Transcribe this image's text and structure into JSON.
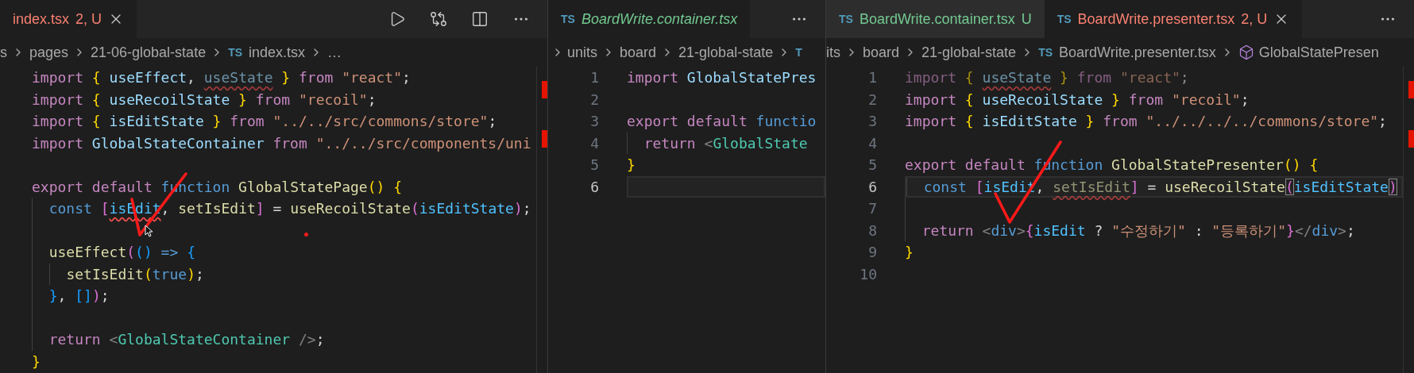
{
  "panes": [
    {
      "tabs": [
        {
          "label": "index.tsx",
          "decoration": "2, U",
          "color": "#f88070",
          "selected": true,
          "closable": true
        }
      ],
      "actions": [
        {
          "kind": "run"
        },
        {
          "kind": "compare"
        },
        {
          "kind": "split"
        },
        {
          "kind": "more"
        }
      ],
      "breadcrumbs": {
        "items": [
          {
            "text": "s"
          },
          {
            "text": "pages"
          },
          {
            "text": "21-06-global-state"
          },
          {
            "badge": "TS",
            "text": "index.tsx"
          },
          {
            "text": "…"
          }
        ]
      },
      "lines": [
        {
          "kind": "code",
          "tokens": [
            {
              "text": "import ",
              "kind": "kw"
            },
            {
              "text": "{ ",
              "kind": "br"
            },
            {
              "text": "useEffect",
              "kind": "id"
            },
            {
              "text": ", ",
              "kind": "plain"
            },
            {
              "text": "useState",
              "kind": "id",
              "faded": true,
              "squiggle": true
            },
            {
              "text": " } ",
              "kind": "br"
            },
            {
              "text": "from ",
              "kind": "kw"
            },
            {
              "text": "\"react\"",
              "kind": "str"
            },
            {
              "text": ";",
              "kind": "plain"
            }
          ]
        },
        {
          "kind": "code",
          "tokens": [
            {
              "text": "import ",
              "kind": "kw"
            },
            {
              "text": "{ ",
              "kind": "br"
            },
            {
              "text": "useRecoilState",
              "kind": "id"
            },
            {
              "text": " } ",
              "kind": "br"
            },
            {
              "text": "from ",
              "kind": "kw"
            },
            {
              "text": "\"recoil\"",
              "kind": "str"
            },
            {
              "text": ";",
              "kind": "plain"
            }
          ]
        },
        {
          "kind": "code",
          "tokens": [
            {
              "text": "import ",
              "kind": "kw"
            },
            {
              "text": "{ ",
              "kind": "br"
            },
            {
              "text": "isEditState",
              "kind": "id"
            },
            {
              "text": " } ",
              "kind": "br"
            },
            {
              "text": "from ",
              "kind": "kw"
            },
            {
              "text": "\"../../src/commons/store\"",
              "kind": "str"
            },
            {
              "text": ";",
              "kind": "plain"
            }
          ]
        },
        {
          "kind": "code",
          "tokens": [
            {
              "text": "import ",
              "kind": "kw"
            },
            {
              "text": "GlobalStateContainer ",
              "kind": "id"
            },
            {
              "text": "from ",
              "kind": "kw"
            },
            {
              "text": "\"../../src/components/uni",
              "kind": "str"
            }
          ]
        },
        {
          "kind": "blank"
        },
        {
          "kind": "code",
          "tokens": [
            {
              "text": "export default ",
              "kind": "kw"
            },
            {
              "text": "function ",
              "kind": "key"
            },
            {
              "text": "GlobalStatePage",
              "kind": "fn"
            },
            {
              "text": "() ",
              "kind": "br"
            },
            {
              "text": "{",
              "kind": "br"
            }
          ],
          "children": [
            {
              "kind": "code",
              "tokens": [
                {
                  "text": "const ",
                  "kind": "key"
                },
                {
                  "text": "[",
                  "kind": "br2"
                },
                {
                  "text": "isEdit",
                  "kind": "const",
                  "squiggle": true
                },
                {
                  "text": ", ",
                  "kind": "plain"
                },
                {
                  "text": "setIsEdit",
                  "kind": "fn"
                },
                {
                  "text": "]",
                  "kind": "br2"
                },
                {
                  "text": " = ",
                  "kind": "plain"
                },
                {
                  "text": "useRecoilState",
                  "kind": "fn"
                },
                {
                  "text": "(",
                  "kind": "br2"
                },
                {
                  "text": "isEditState",
                  "kind": "const"
                },
                {
                  "text": ")",
                  "kind": "br2"
                },
                {
                  "text": ";",
                  "kind": "plain"
                }
              ]
            },
            {
              "kind": "blank"
            },
            {
              "kind": "code",
              "tokens": [
                {
                  "text": "useEffect",
                  "kind": "fn"
                },
                {
                  "text": "(",
                  "kind": "br2"
                },
                {
                  "text": "()",
                  "kind": "br3"
                },
                {
                  "text": " => ",
                  "kind": "key"
                },
                {
                  "text": "{",
                  "kind": "br3"
                }
              ],
              "children": [
                {
                  "kind": "code",
                  "tokens": [
                    {
                      "text": "setIsEdit",
                      "kind": "fn"
                    },
                    {
                      "text": "(",
                      "kind": "br"
                    },
                    {
                      "text": "true",
                      "kind": "key"
                    },
                    {
                      "text": ")",
                      "kind": "br"
                    },
                    {
                      "text": ";",
                      "kind": "plain"
                    }
                  ]
                }
              ]
            },
            {
              "kind": "code",
              "tokens": [
                {
                  "text": "}",
                  "kind": "br3"
                },
                {
                  "text": ", ",
                  "kind": "plain"
                },
                {
                  "text": "[]",
                  "kind": "br3"
                },
                {
                  "text": ")",
                  "kind": "br2"
                },
                {
                  "text": ";",
                  "kind": "plain"
                }
              ]
            },
            {
              "kind": "blank"
            },
            {
              "kind": "code",
              "tokens": [
                {
                  "text": "return ",
                  "kind": "kw"
                },
                {
                  "text": "<",
                  "kind": "tag"
                },
                {
                  "text": "GlobalStateContainer",
                  "kind": "cls"
                },
                {
                  "text": " />",
                  "kind": "tag"
                },
                {
                  "text": ";",
                  "kind": "plain"
                }
              ]
            }
          ]
        },
        {
          "kind": "code",
          "tokens": [
            {
              "text": "}",
              "kind": "br"
            }
          ]
        }
      ]
    },
    {
      "tabs": [
        {
          "badge": "TS",
          "label": "BoardWrite.container.tsx",
          "color": "#73c991",
          "preview": true,
          "selected": true,
          "closable": false
        }
      ],
      "actions": [
        {
          "kind": "more"
        }
      ],
      "breadcrumbs": {
        "leading_chevron": true,
        "items": [
          {
            "text": "units"
          },
          {
            "text": "board"
          },
          {
            "text": "21-global-state"
          },
          {
            "badge": "T"
          }
        ]
      },
      "lines": [
        {
          "kind": "code",
          "number": "1",
          "tokens": [
            {
              "text": "import ",
              "kind": "kw"
            },
            {
              "text": "GlobalStatePres",
              "kind": "id"
            }
          ]
        },
        {
          "kind": "blank",
          "number": "2"
        },
        {
          "kind": "code",
          "number": "3",
          "tokens": [
            {
              "text": "export default ",
              "kind": "kw"
            },
            {
              "text": "functio",
              "kind": "key"
            }
          ],
          "children": [
            {
              "kind": "code",
              "number": "4",
              "tokens": [
                {
                  "text": "return ",
                  "kind": "kw"
                },
                {
                  "text": "<",
                  "kind": "tag"
                },
                {
                  "text": "GlobalState",
                  "kind": "cls"
                }
              ]
            }
          ]
        },
        {
          "kind": "code",
          "number": "5",
          "tokens": [
            {
              "text": "}",
              "kind": "br"
            }
          ]
        },
        {
          "kind": "blank",
          "number": "6",
          "current": true
        }
      ]
    },
    {
      "tabs": [
        {
          "badge": "TS",
          "label": "BoardWrite.container.tsx",
          "decoration": "U",
          "color": "#73c991",
          "selected": false,
          "closable": false
        },
        {
          "badge": "TS",
          "label": "BoardWrite.presenter.tsx",
          "decoration": "2, U",
          "color": "#f88070",
          "selected": true,
          "closable": true
        }
      ],
      "actions": [
        {
          "kind": "more"
        }
      ],
      "breadcrumbs": {
        "items": [
          {
            "text": "its"
          },
          {
            "text": "board"
          },
          {
            "text": "21-global-state"
          },
          {
            "badge": "TS",
            "text": "BoardWrite.presenter.tsx"
          },
          {
            "kind": "symbol",
            "text": "GlobalStatePresen"
          }
        ]
      },
      "lines": [
        {
          "kind": "code",
          "number": "1",
          "faded": true,
          "tokens": [
            {
              "text": "import ",
              "kind": "kw"
            },
            {
              "text": "{ ",
              "kind": "br"
            },
            {
              "text": "useState",
              "kind": "id",
              "squiggle": true
            },
            {
              "text": " } ",
              "kind": "br"
            },
            {
              "text": "from ",
              "kind": "kw"
            },
            {
              "text": "\"react\"",
              "kind": "str"
            },
            {
              "text": ";",
              "kind": "plain"
            }
          ]
        },
        {
          "kind": "code",
          "number": "2",
          "tokens": [
            {
              "text": "import ",
              "kind": "kw"
            },
            {
              "text": "{ ",
              "kind": "br"
            },
            {
              "text": "useRecoilState",
              "kind": "id"
            },
            {
              "text": " } ",
              "kind": "br"
            },
            {
              "text": "from ",
              "kind": "kw"
            },
            {
              "text": "\"recoil\"",
              "kind": "str"
            },
            {
              "text": ";",
              "kind": "plain"
            }
          ]
        },
        {
          "kind": "code",
          "number": "3",
          "tokens": [
            {
              "text": "import ",
              "kind": "kw"
            },
            {
              "text": "{ ",
              "kind": "br"
            },
            {
              "text": "isEditState",
              "kind": "id"
            },
            {
              "text": " } ",
              "kind": "br"
            },
            {
              "text": "from ",
              "kind": "kw"
            },
            {
              "text": "\"../../../../commons/store\"",
              "kind": "str"
            },
            {
              "text": ";",
              "kind": "plain"
            }
          ]
        },
        {
          "kind": "blank",
          "number": "4"
        },
        {
          "kind": "code",
          "number": "5",
          "tokens": [
            {
              "text": "export default ",
              "kind": "kw"
            },
            {
              "text": "function ",
              "kind": "key"
            },
            {
              "text": "GlobalStatePresenter",
              "kind": "fn"
            },
            {
              "text": "() ",
              "kind": "br"
            },
            {
              "text": "{",
              "kind": "br"
            }
          ],
          "children": [
            {
              "kind": "code",
              "number": "6",
              "current": true,
              "tokens": [
                {
                  "text": "const ",
                  "kind": "key"
                },
                {
                  "text": "[",
                  "kind": "br2"
                },
                {
                  "text": "isEdit",
                  "kind": "const"
                },
                {
                  "text": ", ",
                  "kind": "plain"
                },
                {
                  "text": "setIsEdit",
                  "kind": "fn",
                  "faded": true,
                  "squiggle": true
                },
                {
                  "text": "]",
                  "kind": "br2"
                },
                {
                  "text": " = ",
                  "kind": "plain"
                },
                {
                  "text": "useRecoilState",
                  "kind": "fn"
                },
                {
                  "text": "(",
                  "kind": "br2",
                  "bracket_match": true
                },
                {
                  "text": "isEditState",
                  "kind": "const"
                },
                {
                  "text": ")",
                  "kind": "br2",
                  "bracket_match": true
                }
              ]
            },
            {
              "kind": "blank",
              "number": "7"
            },
            {
              "kind": "code",
              "number": "8",
              "tokens": [
                {
                  "text": "return ",
                  "kind": "kw"
                },
                {
                  "text": "<",
                  "kind": "tag"
                },
                {
                  "text": "div",
                  "kind": "key"
                },
                {
                  "text": ">",
                  "kind": "tag"
                },
                {
                  "text": "{",
                  "kind": "br2"
                },
                {
                  "text": "isEdit",
                  "kind": "const"
                },
                {
                  "text": " ? ",
                  "kind": "plain"
                },
                {
                  "text": "\"수정하기\"",
                  "kind": "str"
                },
                {
                  "text": " : ",
                  "kind": "plain"
                },
                {
                  "text": "\"등록하기\"",
                  "kind": "str"
                },
                {
                  "text": "}",
                  "kind": "br2"
                },
                {
                  "text": "</",
                  "kind": "tag"
                },
                {
                  "text": "div",
                  "kind": "key"
                },
                {
                  "text": ">",
                  "kind": "tag"
                },
                {
                  "text": ";",
                  "kind": "plain"
                }
              ]
            }
          ]
        },
        {
          "kind": "code",
          "number": "9",
          "tokens": [
            {
              "text": "}",
              "kind": "br"
            }
          ]
        },
        {
          "kind": "blank",
          "number": "10"
        }
      ]
    }
  ]
}
